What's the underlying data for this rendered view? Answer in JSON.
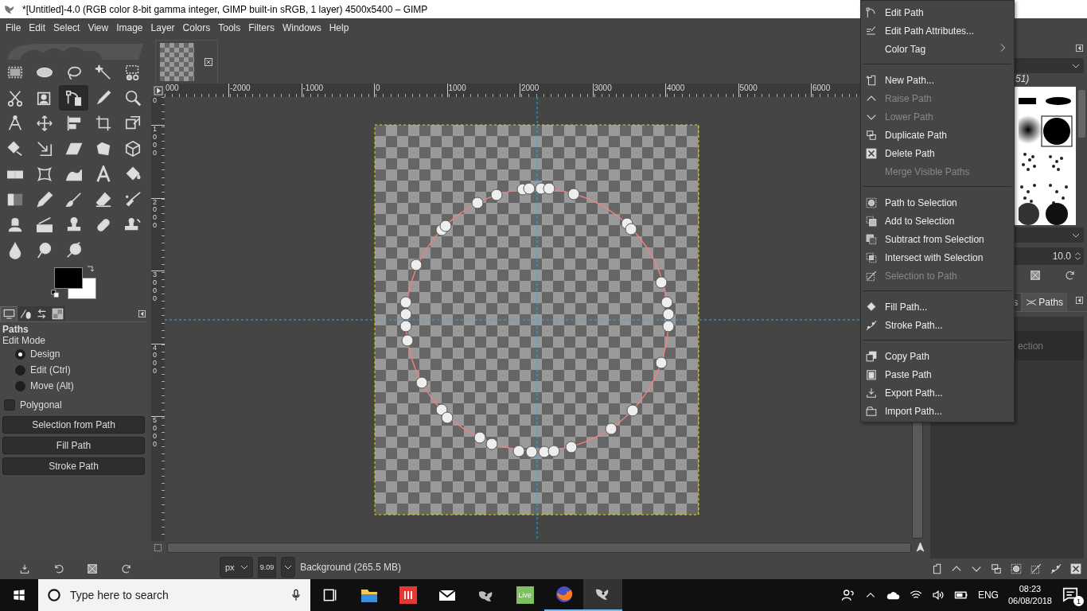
{
  "window": {
    "title": "*[Untitled]-4.0 (RGB color 8-bit gamma integer, GIMP built-in sRGB, 1 layer) 4500x5400 – GIMP"
  },
  "menu_bar": [
    "File",
    "Edit",
    "Select",
    "View",
    "Image",
    "Layer",
    "Colors",
    "Tools",
    "Filters",
    "Windows",
    "Help"
  ],
  "toolbox": {
    "tools": [
      {
        "selected": false
      },
      {
        "selected": false
      },
      {
        "selected": false
      },
      {
        "selected": false
      },
      {
        "selected": false
      },
      {
        "selected": false
      },
      {
        "selected": false
      },
      {
        "selected": true
      },
      {
        "selected": false
      },
      {
        "selected": false
      },
      {
        "selected": false
      },
      {
        "selected": false
      },
      {
        "selected": false
      },
      {
        "selected": false
      },
      {
        "selected": false
      },
      {
        "selected": false
      },
      {
        "selected": false
      },
      {
        "selected": false
      },
      {
        "selected": false
      },
      {
        "selected": false
      },
      {
        "selected": false
      },
      {
        "selected": false
      },
      {
        "selected": false
      },
      {
        "selected": false
      },
      {
        "selected": false
      },
      {
        "selected": false
      },
      {
        "selected": false
      },
      {
        "selected": false
      },
      {
        "selected": false
      },
      {
        "selected": false
      },
      {
        "selected": false
      },
      {
        "selected": false
      },
      {
        "selected": false
      },
      {
        "selected": false
      },
      {
        "selected": false
      },
      {
        "selected": false
      },
      {
        "selected": false
      },
      {
        "selected": false
      }
    ]
  },
  "tool_options": {
    "tabs": [
      {
        "selected": true
      },
      {
        "selected": false
      },
      {
        "selected": false
      },
      {
        "selected": false
      }
    ],
    "title": "Paths",
    "edit_mode_label": "Edit Mode",
    "modes": [
      {
        "label": "Design",
        "selected": true
      },
      {
        "label": "Edit (Ctrl)",
        "selected": false
      },
      {
        "label": "Move (Alt)",
        "selected": false
      }
    ],
    "polygonal": {
      "label": "Polygonal",
      "checked": false
    },
    "buttons": [
      "Selection from Path",
      "Fill Path",
      "Stroke Path"
    ]
  },
  "rulers": {
    "horizontal": [
      "000",
      "-2000",
      "-1000",
      "0",
      "1000",
      "2000",
      "3000",
      "4000",
      "5000",
      "6000"
    ],
    "vertical": [
      "0",
      "1000",
      "2000",
      "3000",
      "4000",
      "5000"
    ]
  },
  "status_bar": {
    "unit": "px",
    "zoom": "9.09",
    "layer_info": "Background (265.5 MB)"
  },
  "context_menu": {
    "groups": [
      [
        {
          "label": "Edit Path",
          "disabled": false
        },
        {
          "label": "Edit Path Attributes...",
          "disabled": false
        },
        {
          "label": "Color Tag",
          "disabled": false,
          "submenu": true
        }
      ],
      [
        {
          "label": "New Path...",
          "disabled": false
        },
        {
          "label": "Raise Path",
          "disabled": true
        },
        {
          "label": "Lower Path",
          "disabled": true
        },
        {
          "label": "Duplicate Path",
          "disabled": false
        },
        {
          "label": "Delete Path",
          "disabled": false
        },
        {
          "label": "Merge Visible Paths",
          "disabled": true
        }
      ],
      [
        {
          "label": "Path to Selection",
          "disabled": false
        },
        {
          "label": "Add to Selection",
          "disabled": false
        },
        {
          "label": "Subtract from Selection",
          "disabled": false
        },
        {
          "label": "Intersect with Selection",
          "disabled": false
        },
        {
          "label": "Selection to Path",
          "disabled": true
        }
      ],
      [
        {
          "label": "Fill Path...",
          "disabled": false
        },
        {
          "label": "Stroke Path...",
          "disabled": false
        }
      ],
      [
        {
          "label": "Copy Path",
          "disabled": false
        },
        {
          "label": "Paste Path",
          "disabled": false
        },
        {
          "label": "Export Path...",
          "disabled": false
        },
        {
          "label": "Import Path...",
          "disabled": false
        }
      ]
    ]
  },
  "right_dock": {
    "brush_count": "51)",
    "spacing": "10.0",
    "tabs": [
      {
        "label": "s",
        "selected": false
      },
      {
        "label": "Paths",
        "selected": true
      }
    ],
    "paths": [
      {
        "name": "ection"
      }
    ]
  },
  "taskbar": {
    "search_placeholder": "Type here to search",
    "apps": [
      {
        "running": false,
        "selected": false
      },
      {
        "running": false,
        "selected": false
      },
      {
        "running": false,
        "selected": false
      },
      {
        "running": false,
        "selected": false
      },
      {
        "label": "Live",
        "running": false,
        "selected": false
      },
      {
        "running": true,
        "selected": false
      },
      {
        "running": true,
        "selected": true
      }
    ],
    "language": "ENG",
    "time": "08:23",
    "date": "06/08/2018",
    "notifications": "1"
  }
}
